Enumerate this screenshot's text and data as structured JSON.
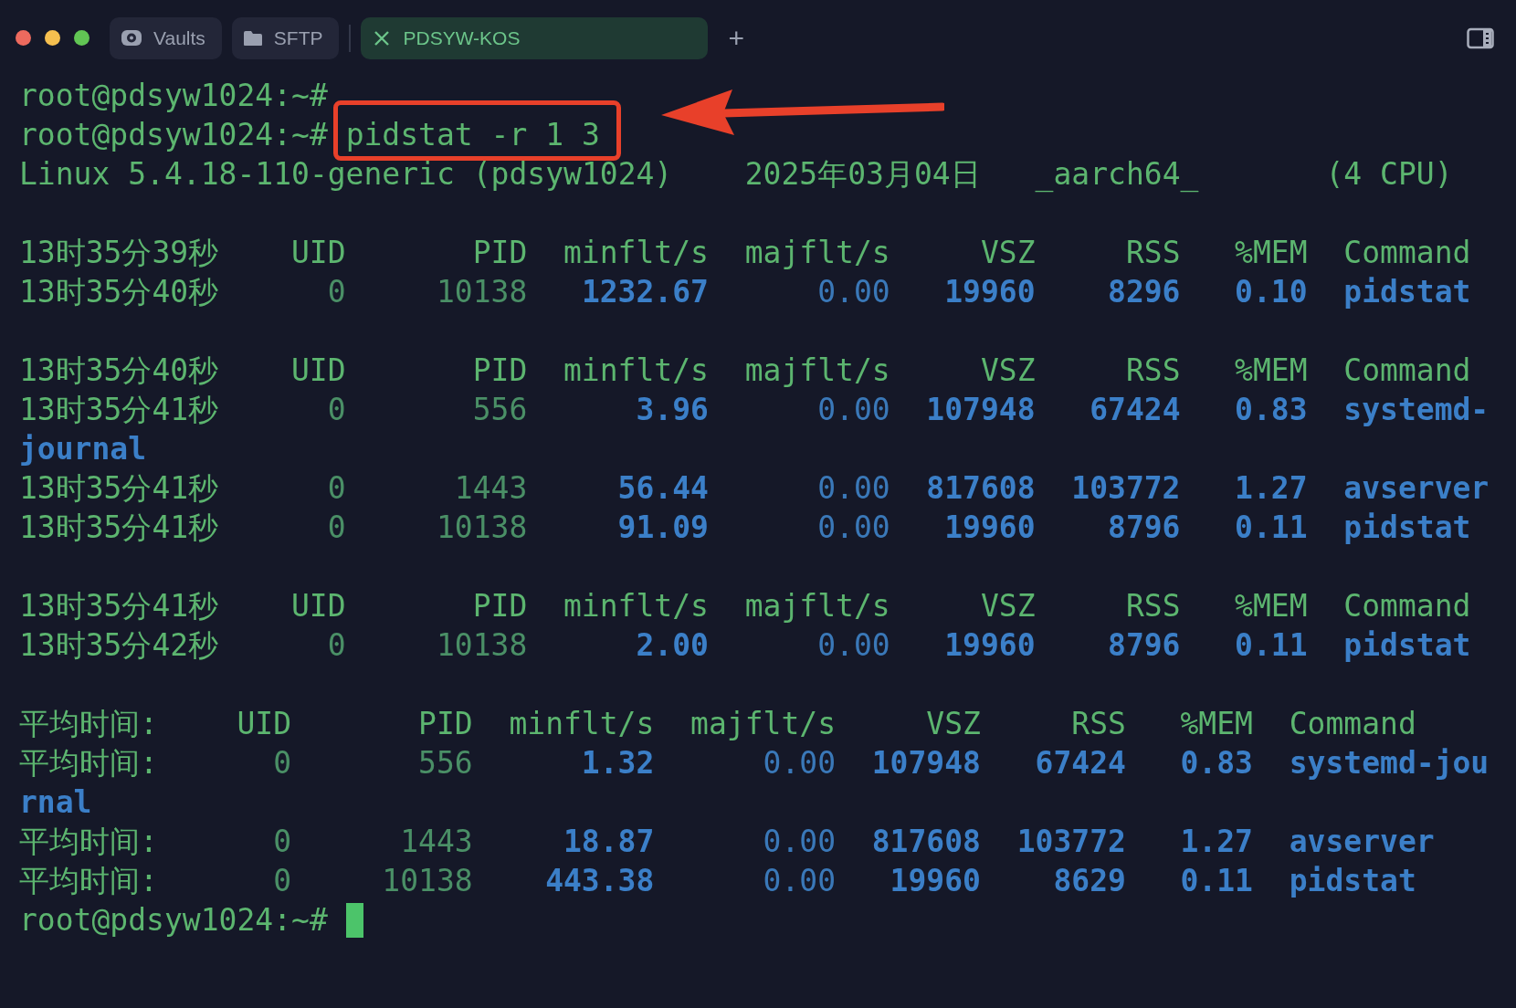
{
  "tabs": [
    {
      "label": "Vaults",
      "kind": "vaults",
      "selected": false
    },
    {
      "label": "SFTP",
      "kind": "sftp",
      "selected": false
    },
    {
      "label": "PDSYW-KOS",
      "kind": "session",
      "selected": true
    }
  ],
  "new_tab": "+",
  "lines": [
    {
      "kind": "prompt",
      "prompt": "root@pdsyw1024:~#"
    },
    {
      "kind": "prompt",
      "prompt": "root@pdsyw1024:~#",
      "command": "pidstat -r 1 3"
    },
    {
      "kind": "info",
      "cells": [
        "Linux 5.4.18-110-generic (pdsyw1024)",
        "2025年03月04日",
        "_aarch64_",
        "(4 CPU)"
      ]
    },
    {
      "kind": "blank"
    },
    {
      "kind": "header",
      "cells": [
        "13时35分39秒",
        "UID",
        "PID",
        "minflt/s",
        "majflt/s",
        "VSZ",
        "RSS",
        "%MEM",
        "Command"
      ]
    },
    {
      "kind": "row",
      "cells": [
        "13时35分40秒",
        "0",
        "10138",
        "1232.67",
        "0.00",
        "19960",
        "8296",
        "0.10",
        "pidstat"
      ]
    },
    {
      "kind": "blank"
    },
    {
      "kind": "header",
      "cells": [
        "13时35分40秒",
        "UID",
        "PID",
        "minflt/s",
        "majflt/s",
        "VSZ",
        "RSS",
        "%MEM",
        "Command"
      ]
    },
    {
      "kind": "row",
      "cells": [
        "13时35分41秒",
        "0",
        "556",
        "3.96",
        "0.00",
        "107948",
        "67424",
        "0.83",
        "systemd-"
      ]
    },
    {
      "kind": "wrap",
      "text": "journal"
    },
    {
      "kind": "row",
      "cells": [
        "13时35分41秒",
        "0",
        "1443",
        "56.44",
        "0.00",
        "817608",
        "103772",
        "1.27",
        "avserver"
      ]
    },
    {
      "kind": "row",
      "cells": [
        "13时35分41秒",
        "0",
        "10138",
        "91.09",
        "0.00",
        "19960",
        "8796",
        "0.11",
        "pidstat"
      ]
    },
    {
      "kind": "blank"
    },
    {
      "kind": "header",
      "cells": [
        "13时35分41秒",
        "UID",
        "PID",
        "minflt/s",
        "majflt/s",
        "VSZ",
        "RSS",
        "%MEM",
        "Command"
      ]
    },
    {
      "kind": "row",
      "cells": [
        "13时35分42秒",
        "0",
        "10138",
        "2.00",
        "0.00",
        "19960",
        "8796",
        "0.11",
        "pidstat"
      ]
    },
    {
      "kind": "blank"
    },
    {
      "kind": "average-header",
      "cells": [
        "平均时间:",
        "UID",
        "PID",
        "minflt/s",
        "majflt/s",
        "VSZ",
        "RSS",
        "%MEM",
        "Command"
      ]
    },
    {
      "kind": "average-row",
      "cells": [
        "平均时间:",
        "0",
        "556",
        "1.32",
        "0.00",
        "107948",
        "67424",
        "0.83",
        "systemd-jou"
      ]
    },
    {
      "kind": "wrap",
      "text": "rnal"
    },
    {
      "kind": "average-row",
      "cells": [
        "平均时间:",
        "0",
        "1443",
        "18.87",
        "0.00",
        "817608",
        "103772",
        "1.27",
        "avserver"
      ]
    },
    {
      "kind": "average-row",
      "cells": [
        "平均时间:",
        "0",
        "10138",
        "443.38",
        "0.00",
        "19960",
        "8629",
        "0.11",
        "pidstat"
      ]
    },
    {
      "kind": "prompt",
      "prompt": "root@pdsyw1024:~#",
      "cursor": true
    }
  ]
}
